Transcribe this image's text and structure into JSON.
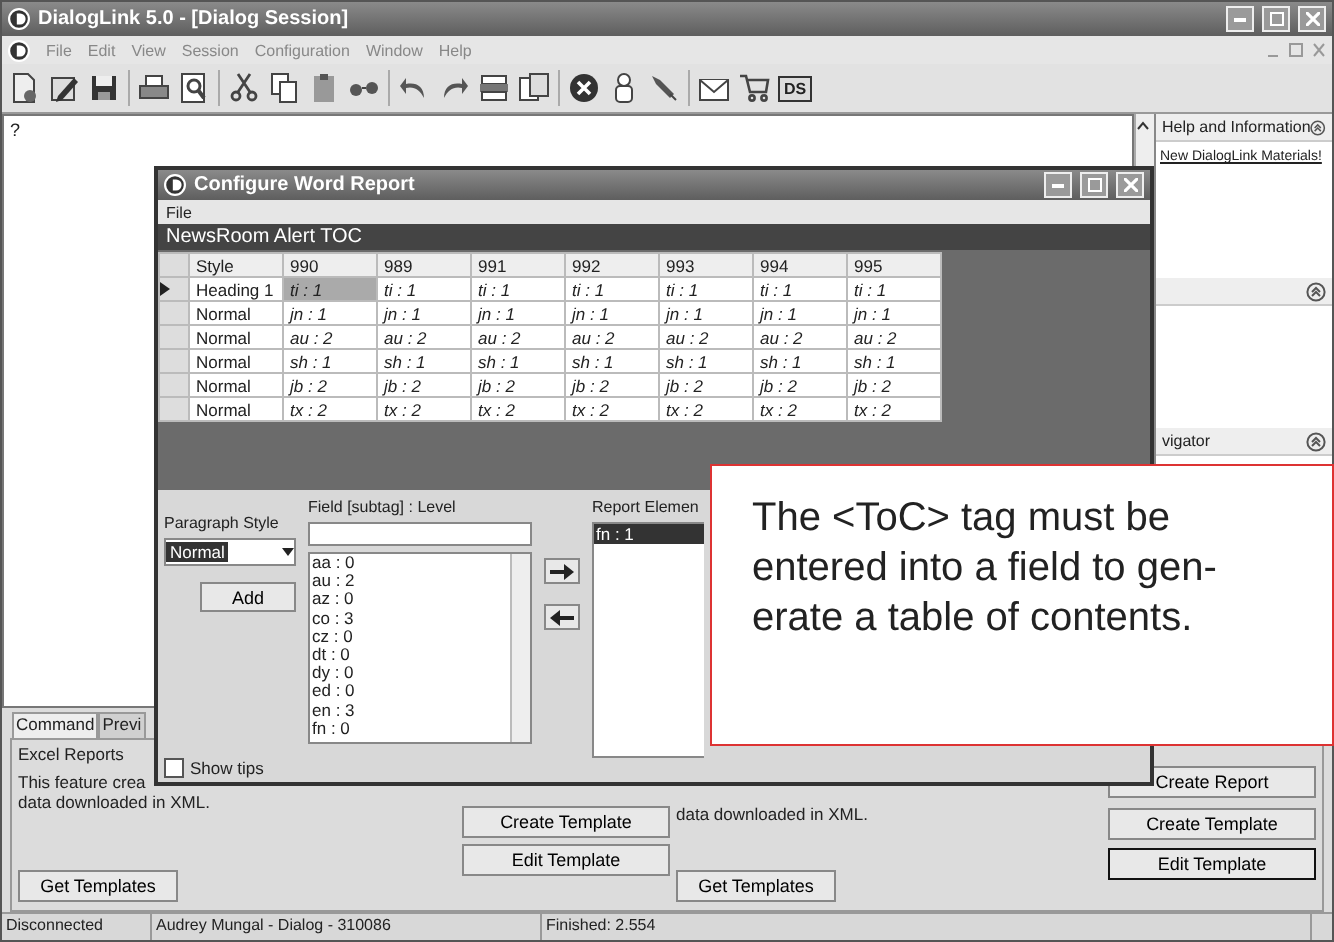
{
  "window": {
    "title": "DialogLink 5.0 - [Dialog Session]"
  },
  "menu": [
    "File",
    "Edit",
    "View",
    "Session",
    "Configuration",
    "Window",
    "Help"
  ],
  "toolbar": {
    "ds_label": "DS"
  },
  "document": {
    "text": "?"
  },
  "side_panel": {
    "help_title": "Help and Information",
    "help_link": "New DialogLink Materials!",
    "section_3_title": "vigator"
  },
  "bottom_tabs": [
    {
      "label": "Command",
      "selected": true
    },
    {
      "label": "Previ",
      "selected": false
    }
  ],
  "excel_reports": {
    "title": "Excel Reports",
    "left_lines": [
      "This feature crea",
      "data downloaded in XML."
    ],
    "left_buttons": [
      "Create Template",
      "Edit Template",
      "Get Templates"
    ],
    "right_line": "data downloaded in XML.",
    "right_buttons": [
      {
        "label": "Create Report",
        "focused": false
      },
      {
        "label": "Create Template",
        "focused": false
      },
      {
        "label": "Edit Template",
        "focused": true
      },
      {
        "label": "Get Templates",
        "focused": false
      }
    ]
  },
  "status_bar": [
    "Disconnected",
    "Audrey Mungal - Dialog - 310086",
    "Finished: 2.554"
  ],
  "dialog": {
    "title": "Configure Word Report",
    "menu": [
      "File"
    ],
    "header": "NewsRoom Alert TOC",
    "table": {
      "columns": [
        "Style",
        "990",
        "989",
        "991",
        "992",
        "993",
        "994",
        "995"
      ],
      "rows": [
        {
          "current": true,
          "cells": [
            {
              "text": "Heading 1",
              "selected": false
            },
            {
              "text": "ti : 1",
              "selected": true
            },
            {
              "text": "ti : 1",
              "selected": false
            },
            {
              "text": "ti : 1",
              "selected": false
            },
            {
              "text": "ti : 1",
              "selected": false
            },
            {
              "text": "ti : 1",
              "selected": false
            },
            {
              "text": "ti : 1",
              "selected": false
            },
            {
              "text": "ti : 1",
              "selected": false
            }
          ]
        },
        {
          "current": false,
          "cells": [
            {
              "text": "Normal",
              "selected": false
            },
            {
              "text": "jn : 1",
              "selected": false
            },
            {
              "text": "jn : 1",
              "selected": false
            },
            {
              "text": "jn : 1",
              "selected": false
            },
            {
              "text": "jn : 1",
              "selected": false
            },
            {
              "text": "jn : 1",
              "selected": false
            },
            {
              "text": "jn : 1",
              "selected": false
            },
            {
              "text": "jn : 1",
              "selected": false
            }
          ]
        },
        {
          "current": false,
          "cells": [
            {
              "text": "Normal",
              "selected": false
            },
            {
              "text": "au : 2",
              "selected": false
            },
            {
              "text": "au : 2",
              "selected": false
            },
            {
              "text": "au : 2",
              "selected": false
            },
            {
              "text": "au : 2",
              "selected": false
            },
            {
              "text": "au : 2",
              "selected": false
            },
            {
              "text": "au : 2",
              "selected": false
            },
            {
              "text": "au : 2",
              "selected": false
            }
          ]
        },
        {
          "current": false,
          "cells": [
            {
              "text": "Normal",
              "selected": false
            },
            {
              "text": "sh : 1",
              "selected": false
            },
            {
              "text": "sh : 1",
              "selected": false
            },
            {
              "text": "sh : 1",
              "selected": false
            },
            {
              "text": "sh : 1",
              "selected": false
            },
            {
              "text": "sh : 1",
              "selected": false
            },
            {
              "text": "sh : 1",
              "selected": false
            },
            {
              "text": "sh : 1",
              "selected": false
            }
          ]
        },
        {
          "current": false,
          "cells": [
            {
              "text": "Normal",
              "selected": false
            },
            {
              "text": "jb : 2",
              "selected": false
            },
            {
              "text": "jb : 2",
              "selected": false
            },
            {
              "text": "jb : 2",
              "selected": false
            },
            {
              "text": "jb : 2",
              "selected": false
            },
            {
              "text": "jb : 2",
              "selected": false
            },
            {
              "text": "jb : 2",
              "selected": false
            },
            {
              "text": "jb : 2",
              "selected": false
            }
          ]
        },
        {
          "current": false,
          "cells": [
            {
              "text": "Normal",
              "selected": false
            },
            {
              "text": "tx : 2",
              "selected": false
            },
            {
              "text": "tx : 2",
              "selected": false
            },
            {
              "text": "tx : 2",
              "selected": false
            },
            {
              "text": "tx : 2",
              "selected": false
            },
            {
              "text": "tx : 2",
              "selected": false
            },
            {
              "text": "tx : 2",
              "selected": false
            },
            {
              "text": "tx : 2",
              "selected": false
            }
          ]
        }
      ]
    },
    "paragraph_style": {
      "label": "Paragraph Style",
      "value": "Normal"
    },
    "add_button": "Add",
    "field": {
      "label": "Field [subtag] : Level",
      "items": [
        "aa : 0",
        "au : 2",
        "az : 0",
        "co : 3",
        "cz : 0",
        "dt : 0",
        "dy : 0",
        "ed : 0",
        "en : 3",
        "fn : 0"
      ]
    },
    "report_elements": {
      "label": "Report Elemen",
      "items": [
        {
          "text": "fn : 1",
          "selected": true
        }
      ]
    },
    "show_tips": {
      "label": "Show tips",
      "checked": false
    }
  },
  "callout": {
    "lines": [
      "The <ToC> tag must be",
      "entered into a field to gen-",
      "erate a table of contents."
    ]
  }
}
